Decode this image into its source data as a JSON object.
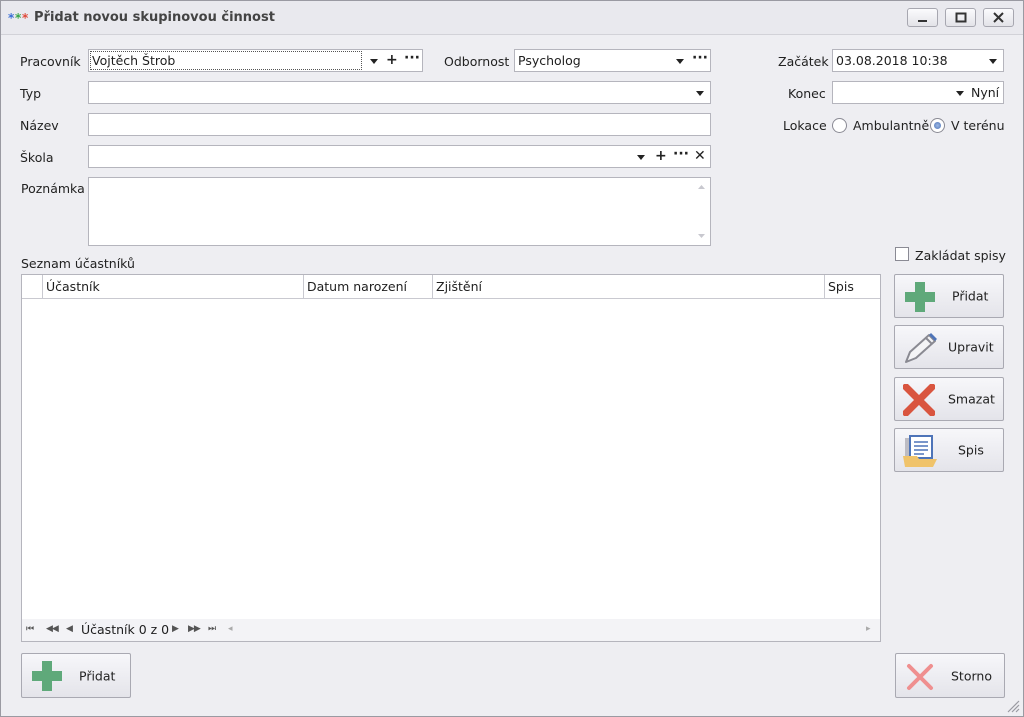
{
  "window": {
    "title": "Přidat novou skupinovou činnost"
  },
  "form": {
    "pracovnik": {
      "label": "Pracovník",
      "value": "Vojtěch Štrob"
    },
    "odbornost": {
      "label": "Odbornost",
      "value": "Psycholog"
    },
    "zacatek": {
      "label": "Začátek",
      "value": "03.08.2018 10:38"
    },
    "typ": {
      "label": "Typ",
      "value": ""
    },
    "konec": {
      "label": "Konec",
      "value": "",
      "now_label": "Nyní"
    },
    "nazev": {
      "label": "Název",
      "value": ""
    },
    "lokace": {
      "label": "Lokace",
      "options": [
        {
          "label": "Ambulantně",
          "checked": false
        },
        {
          "label": "V terénu",
          "checked": true
        }
      ]
    },
    "skola": {
      "label": "Škola",
      "value": ""
    },
    "poznamka": {
      "label": "Poznámka",
      "value": ""
    }
  },
  "participants": {
    "title": "Seznam účastníků",
    "columns": [
      "Účastník",
      "Datum narození",
      "Zjištění",
      "Spis"
    ],
    "rows": [],
    "navigator_text": "Účastník 0 z 0",
    "zakladat_spisy": {
      "label": "Zakládat spisy",
      "checked": false
    }
  },
  "side_buttons": {
    "pridat": "Přidat",
    "upravit": "Upravit",
    "smazat": "Smazat",
    "spis": "Spis"
  },
  "bottom": {
    "pridat": "Přidat",
    "storno": "Storno"
  },
  "colors": {
    "green_plus": "#5fa97a",
    "red_x": "#d9553f",
    "light_red_x": "#ef8f8f",
    "accent_blue": "#4e74b8"
  }
}
